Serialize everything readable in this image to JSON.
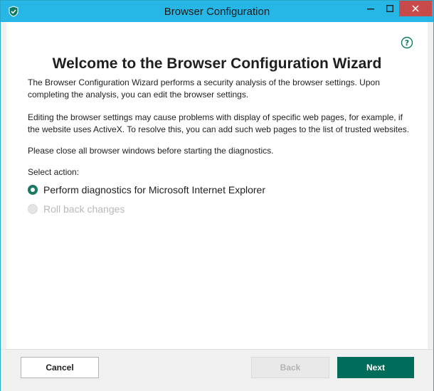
{
  "window": {
    "title": "Browser Configuration",
    "app_icon": "kaspersky-shield-icon",
    "controls": [
      "minimize-icon",
      "maximize-icon",
      "close-icon"
    ]
  },
  "content": {
    "help_icon": "question-icon",
    "heading": "Welcome to the Browser Configuration Wizard",
    "paragraphs": [
      "The Browser Configuration Wizard performs a security analysis of the browser settings. Upon completing the analysis, you can edit the browser settings.",
      "Editing the browser settings may cause problems with display of specific web pages, for example, if the website uses ActiveX. To resolve this, you can add such web pages to the list of trusted websites.",
      "Please close all browser windows before starting the diagnostics."
    ],
    "select_label": "Select action:",
    "options": [
      {
        "label": "Perform diagnostics for Microsoft Internet Explorer",
        "selected": true,
        "enabled": true
      },
      {
        "label": "Roll back changes",
        "selected": false,
        "enabled": false
      }
    ]
  },
  "footer": {
    "cancel_label": "Cancel",
    "back_label": "Back",
    "next_label": "Next"
  },
  "colors": {
    "titlebar": "#27b7e6",
    "accent": "#006d5b",
    "close": "#c94a4a"
  }
}
